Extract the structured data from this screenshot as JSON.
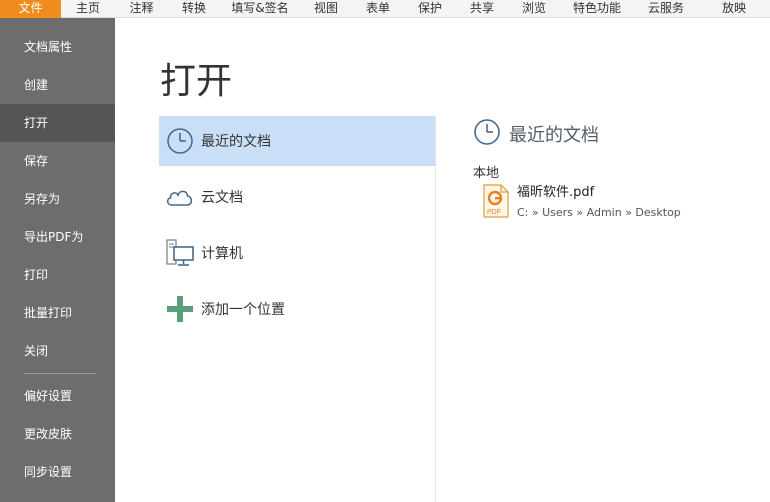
{
  "menu": {
    "items": [
      "文件",
      "主页",
      "注释",
      "转换",
      "填写&签名",
      "视图",
      "表单",
      "保护",
      "共享",
      "浏览",
      "特色功能",
      "云服务",
      "放映"
    ]
  },
  "sidebar": {
    "items": [
      "文档属性",
      "创建",
      "打开",
      "保存",
      "另存为",
      "导出PDF为",
      "打印",
      "批量打印",
      "关闭",
      "偏好设置",
      "更改皮肤",
      "同步设置"
    ],
    "active": "打开"
  },
  "main": {
    "title": "打开",
    "places": [
      "最近的文档",
      "云文档",
      "计算机",
      "添加一个位置"
    ],
    "recent": {
      "title": "最近的文档",
      "section": "本地",
      "file_name": "福昕软件.pdf",
      "file_path": "C: » Users » Admin » Desktop",
      "file_icon_text": "PDF"
    }
  },
  "colors": {
    "accent": "#f08c1e",
    "sidebar_bg": "#6d6d6d",
    "sidebar_active": "#555555",
    "selected_row": "#c9dff8"
  }
}
